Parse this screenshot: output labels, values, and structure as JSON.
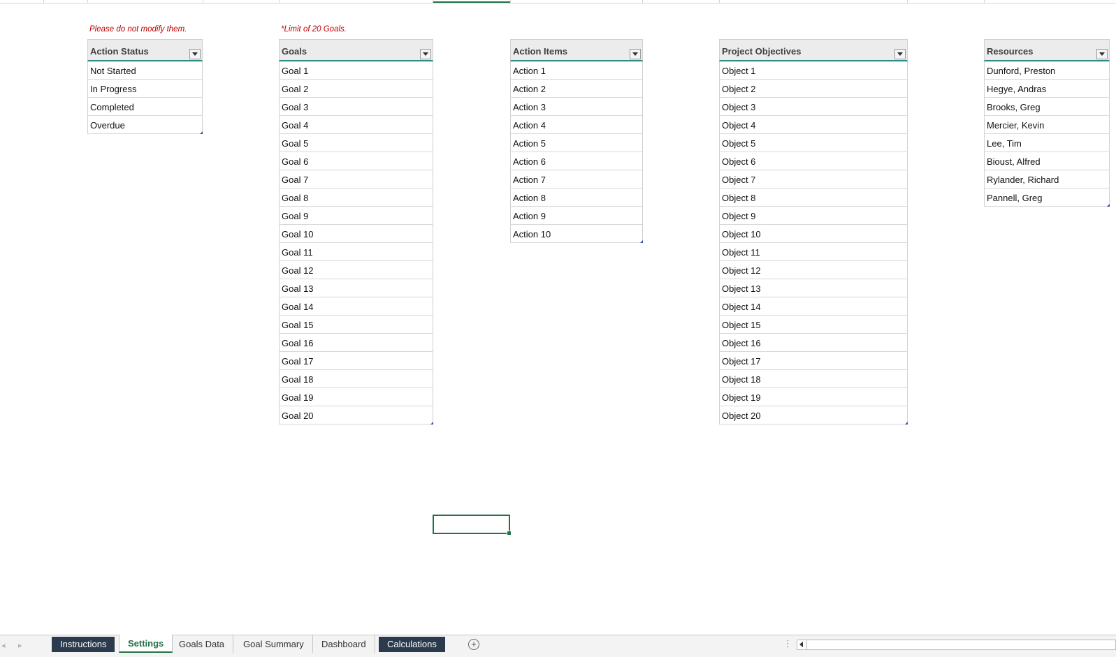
{
  "notes": {
    "status_note": "Please do not modify them.",
    "goals_note": "*Limit of 20 Goals."
  },
  "tables": {
    "action_status": {
      "header": "Action Status",
      "rows": [
        "Not Started",
        "In Progress",
        "Completed",
        "Overdue"
      ]
    },
    "goals": {
      "header": "Goals",
      "rows": [
        "Goal 1",
        "Goal 2",
        "Goal 3",
        "Goal 4",
        "Goal 5",
        "Goal 6",
        "Goal 7",
        "Goal 8",
        "Goal 9",
        "Goal 10",
        "Goal 11",
        "Goal 12",
        "Goal 13",
        "Goal 14",
        "Goal 15",
        "Goal 16",
        "Goal 17",
        "Goal 18",
        "Goal 19",
        "Goal 20"
      ]
    },
    "action_items": {
      "header": "Action Items",
      "rows": [
        "Action 1",
        "Action 2",
        "Action 3",
        "Action 4",
        "Action 5",
        "Action 6",
        "Action 7",
        "Action 8",
        "Action 9",
        "Action 10"
      ]
    },
    "project_objectives": {
      "header": "Project Objectives",
      "rows": [
        "Object 1",
        "Object 2",
        "Object 3",
        "Object 4",
        "Object 5",
        "Object 6",
        "Object 7",
        "Object 8",
        "Object 9",
        "Object 10",
        "Object 11",
        "Object 12",
        "Object 13",
        "Object 14",
        "Object 15",
        "Object 16",
        "Object 17",
        "Object 18",
        "Object 19",
        "Object 20"
      ]
    },
    "resources": {
      "header": "Resources",
      "rows": [
        "Dunford, Preston",
        "Hegye, Andras",
        "Brooks, Greg",
        "Mercier, Kevin",
        "Lee, Tim",
        "Bioust, Alfred",
        "Rylander, Richard",
        "Pannell, Greg"
      ]
    }
  },
  "sheet_tabs": [
    {
      "label": "Instructions",
      "style": "dark"
    },
    {
      "label": "Settings",
      "style": "active"
    },
    {
      "label": "Goals Data",
      "style": "normal"
    },
    {
      "label": "Goal Summary",
      "style": "normal"
    },
    {
      "label": "Dashboard",
      "style": "normal"
    },
    {
      "label": "Calculations",
      "style": "dark"
    }
  ],
  "tabbar": {
    "add_sheet_symbol": "+",
    "splitter_symbol": "⋮"
  },
  "colors": {
    "accent": "#217346",
    "header_rule": "#2a8a8a",
    "note_red": "#c00000",
    "dark_tab": "#2c3a4e"
  }
}
